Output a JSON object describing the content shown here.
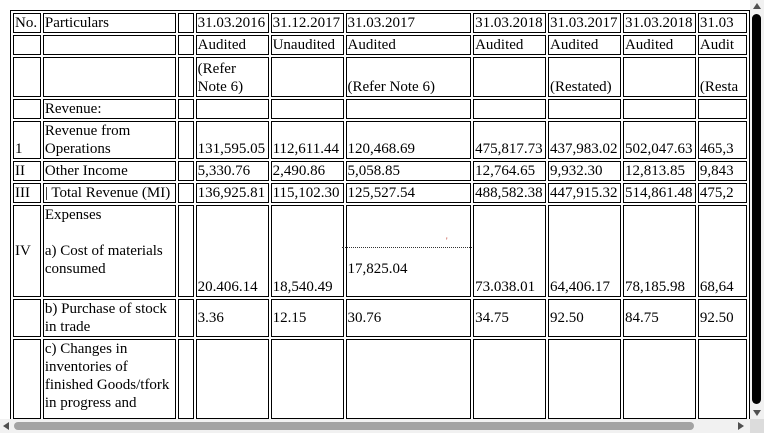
{
  "header": {
    "no": "No.",
    "particulars": "Particulars",
    "dates": [
      "31.03.2016",
      "31.12.2017",
      "31.03.2017",
      "31.03.2018",
      "31.03.2017",
      "31.03.2018",
      "31.03"
    ],
    "status": [
      "Audited",
      "Unaudited",
      "Audited",
      "Audited",
      "Audited",
      "Audited",
      "Audit"
    ],
    "notes": [
      "(Refer Note 6)",
      "",
      "(Refer Note 6)",
      "",
      "(Restated)",
      "",
      "(Resta"
    ]
  },
  "rows": {
    "revenue_label": "Revenue:",
    "rev_ops": {
      "no": "1",
      "label": "Revenue from Operations",
      "values": [
        "131,595.05",
        "112,611.44",
        "120,468.69",
        "475,817.73",
        "437,983.02",
        "502,047.63",
        "465,3"
      ]
    },
    "other_income": {
      "no": "II",
      "label": "Other Income",
      "values": [
        "5,330.76",
        "2,490.86",
        "5,058.85",
        "12,764.65",
        "9,932.30",
        "12,813.85",
        "9,843"
      ]
    },
    "total_revenue": {
      "no": "III",
      "label": "| Total Revenue (MI)",
      "values": [
        "136,925.81",
        "115,102.30",
        "125,527.54",
        "488,582.38",
        "447,915.32",
        "514,861.48",
        "475,2"
      ]
    },
    "expenses": {
      "no": "IV",
      "label": "Expenses",
      "sublabel": "a) Cost of materials consumed",
      "values": [
        "20.406.14",
        "18,540.49",
        "17,825.04",
        "73.038.01",
        "64,406.17",
        "78,185.98",
        "68,64"
      ],
      "tick": "'"
    },
    "purchase": {
      "label": "b) Purchase of stock in trade",
      "values": [
        "3.36",
        "12.15",
        "30.76",
        "34.75",
        "92.50",
        "84.75",
        "92.50"
      ]
    },
    "changes": {
      "label": "c) Changes in inventories of finished Goods/tfork in progress and"
    }
  }
}
